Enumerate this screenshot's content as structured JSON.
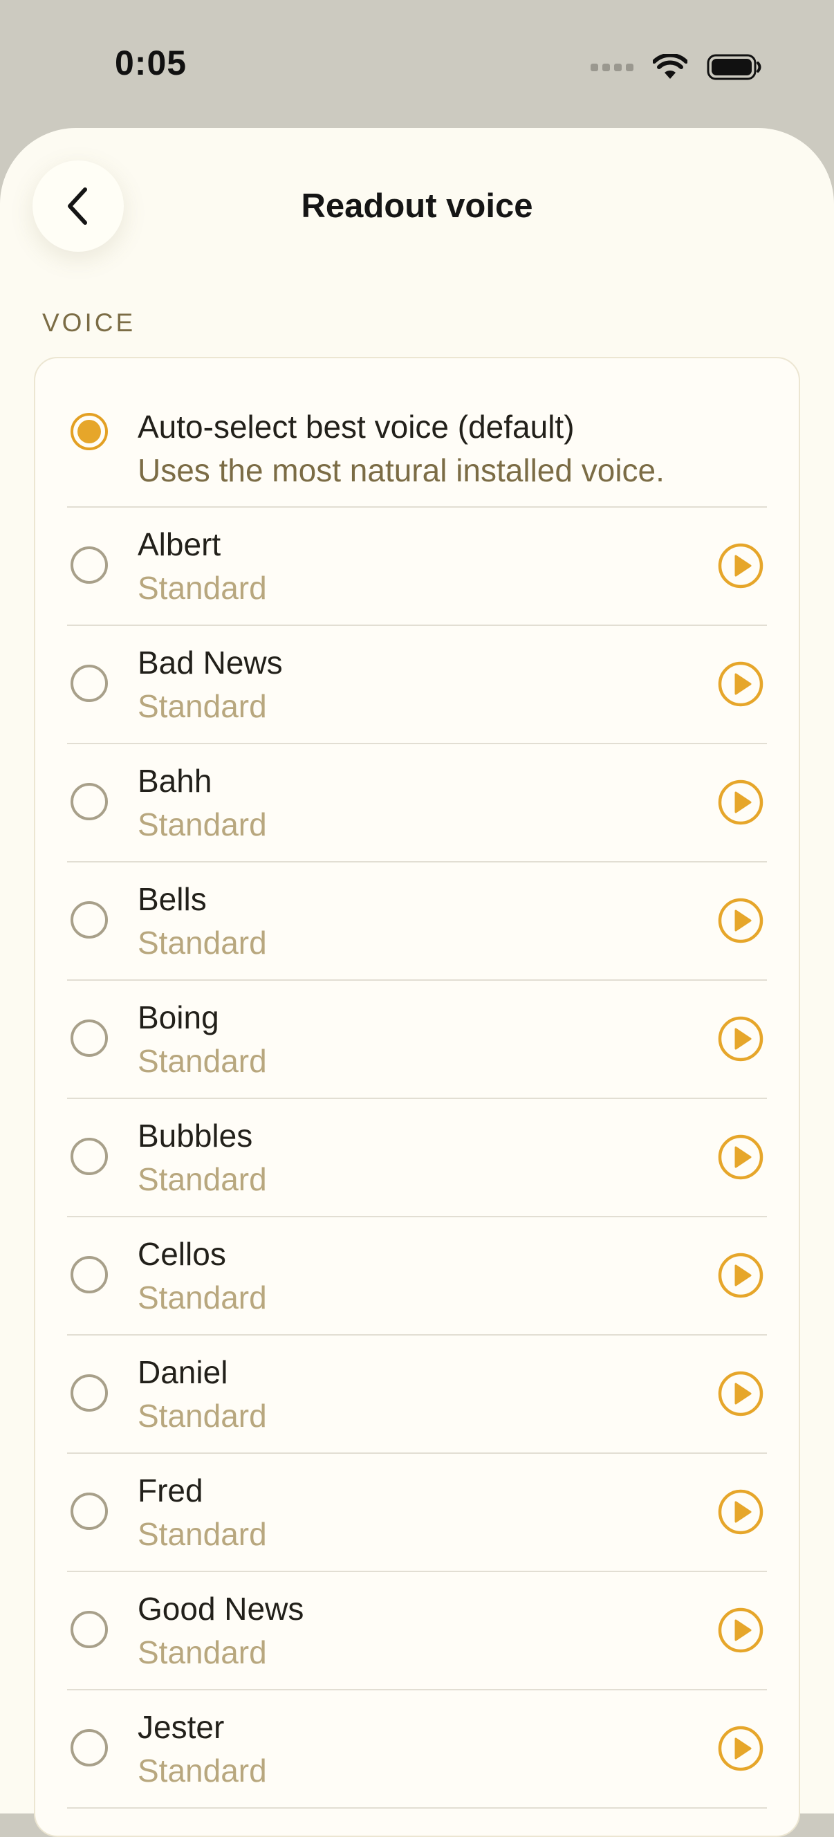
{
  "status_bar": {
    "time": "0:05"
  },
  "header": {
    "title": "Readout voice",
    "back_icon": "chevron-left-icon"
  },
  "section": {
    "label": "VOICE"
  },
  "colors": {
    "accent": "#E6A62A",
    "sheet_background": "#FDFBF2",
    "subtitle": "#B8A77E"
  },
  "voices": [
    {
      "name": "Auto-select best voice (default)",
      "subtitle": "Uses the most natural installed voice.",
      "selected": true,
      "has_preview": false
    },
    {
      "name": "Albert",
      "subtitle": "Standard",
      "selected": false,
      "has_preview": true
    },
    {
      "name": "Bad News",
      "subtitle": "Standard",
      "selected": false,
      "has_preview": true
    },
    {
      "name": "Bahh",
      "subtitle": "Standard",
      "selected": false,
      "has_preview": true
    },
    {
      "name": "Bells",
      "subtitle": "Standard",
      "selected": false,
      "has_preview": true
    },
    {
      "name": "Boing",
      "subtitle": "Standard",
      "selected": false,
      "has_preview": true
    },
    {
      "name": "Bubbles",
      "subtitle": "Standard",
      "selected": false,
      "has_preview": true
    },
    {
      "name": "Cellos",
      "subtitle": "Standard",
      "selected": false,
      "has_preview": true
    },
    {
      "name": "Daniel",
      "subtitle": "Standard",
      "selected": false,
      "has_preview": true
    },
    {
      "name": "Fred",
      "subtitle": "Standard",
      "selected": false,
      "has_preview": true
    },
    {
      "name": "Good News",
      "subtitle": "Standard",
      "selected": false,
      "has_preview": true
    },
    {
      "name": "Jester",
      "subtitle": "Standard",
      "selected": false,
      "has_preview": true
    }
  ]
}
